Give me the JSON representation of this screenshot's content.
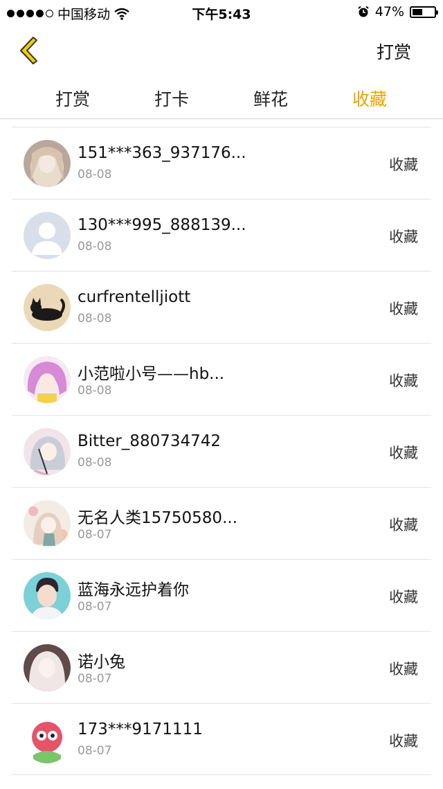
{
  "status_bar": {
    "carrier": "中国移动",
    "time": "下午5:43",
    "battery": "47%",
    "battery_level": 0.47
  },
  "nav": {
    "right_button": "打赏"
  },
  "tabs": [
    {
      "label": "打赏",
      "active": false
    },
    {
      "label": "打卡",
      "active": false
    },
    {
      "label": "鲜花",
      "active": false
    },
    {
      "label": "收藏",
      "active": true
    }
  ],
  "colors": {
    "accent": "#f0a100",
    "back_icon_fill": "#f3d000"
  },
  "list": [
    {
      "name": "151***363_937176...",
      "date": "08-08",
      "action": "收藏",
      "avatar_icon": "avatar-anime-girl-icon"
    },
    {
      "name": "130***995_888139...",
      "date": "08-08",
      "action": "收藏",
      "avatar_icon": "avatar-default-person-icon"
    },
    {
      "name": "curfrentelljiott",
      "date": "08-08",
      "action": "收藏",
      "avatar_icon": "avatar-black-cat-icon"
    },
    {
      "name": "小范啦小号——hb...",
      "date": "08-08",
      "action": "收藏",
      "avatar_icon": "avatar-anime-pink-icon"
    },
    {
      "name": "Bitter_880734742",
      "date": "08-08",
      "action": "收藏",
      "avatar_icon": "avatar-anime-silver-icon"
    },
    {
      "name": "无名人类15750580...",
      "date": "08-07",
      "action": "收藏",
      "avatar_icon": "avatar-anime-floral-icon"
    },
    {
      "name": "蓝海永远护着你",
      "date": "08-07",
      "action": "收藏",
      "avatar_icon": "avatar-boy-icon"
    },
    {
      "name": "诺小兔",
      "date": "08-07",
      "action": "收藏",
      "avatar_icon": "avatar-anime-white-hair-icon"
    },
    {
      "name": "173***9171111",
      "date": "08-07",
      "action": "收藏",
      "avatar_icon": "avatar-cartoon-mascot-icon"
    }
  ]
}
